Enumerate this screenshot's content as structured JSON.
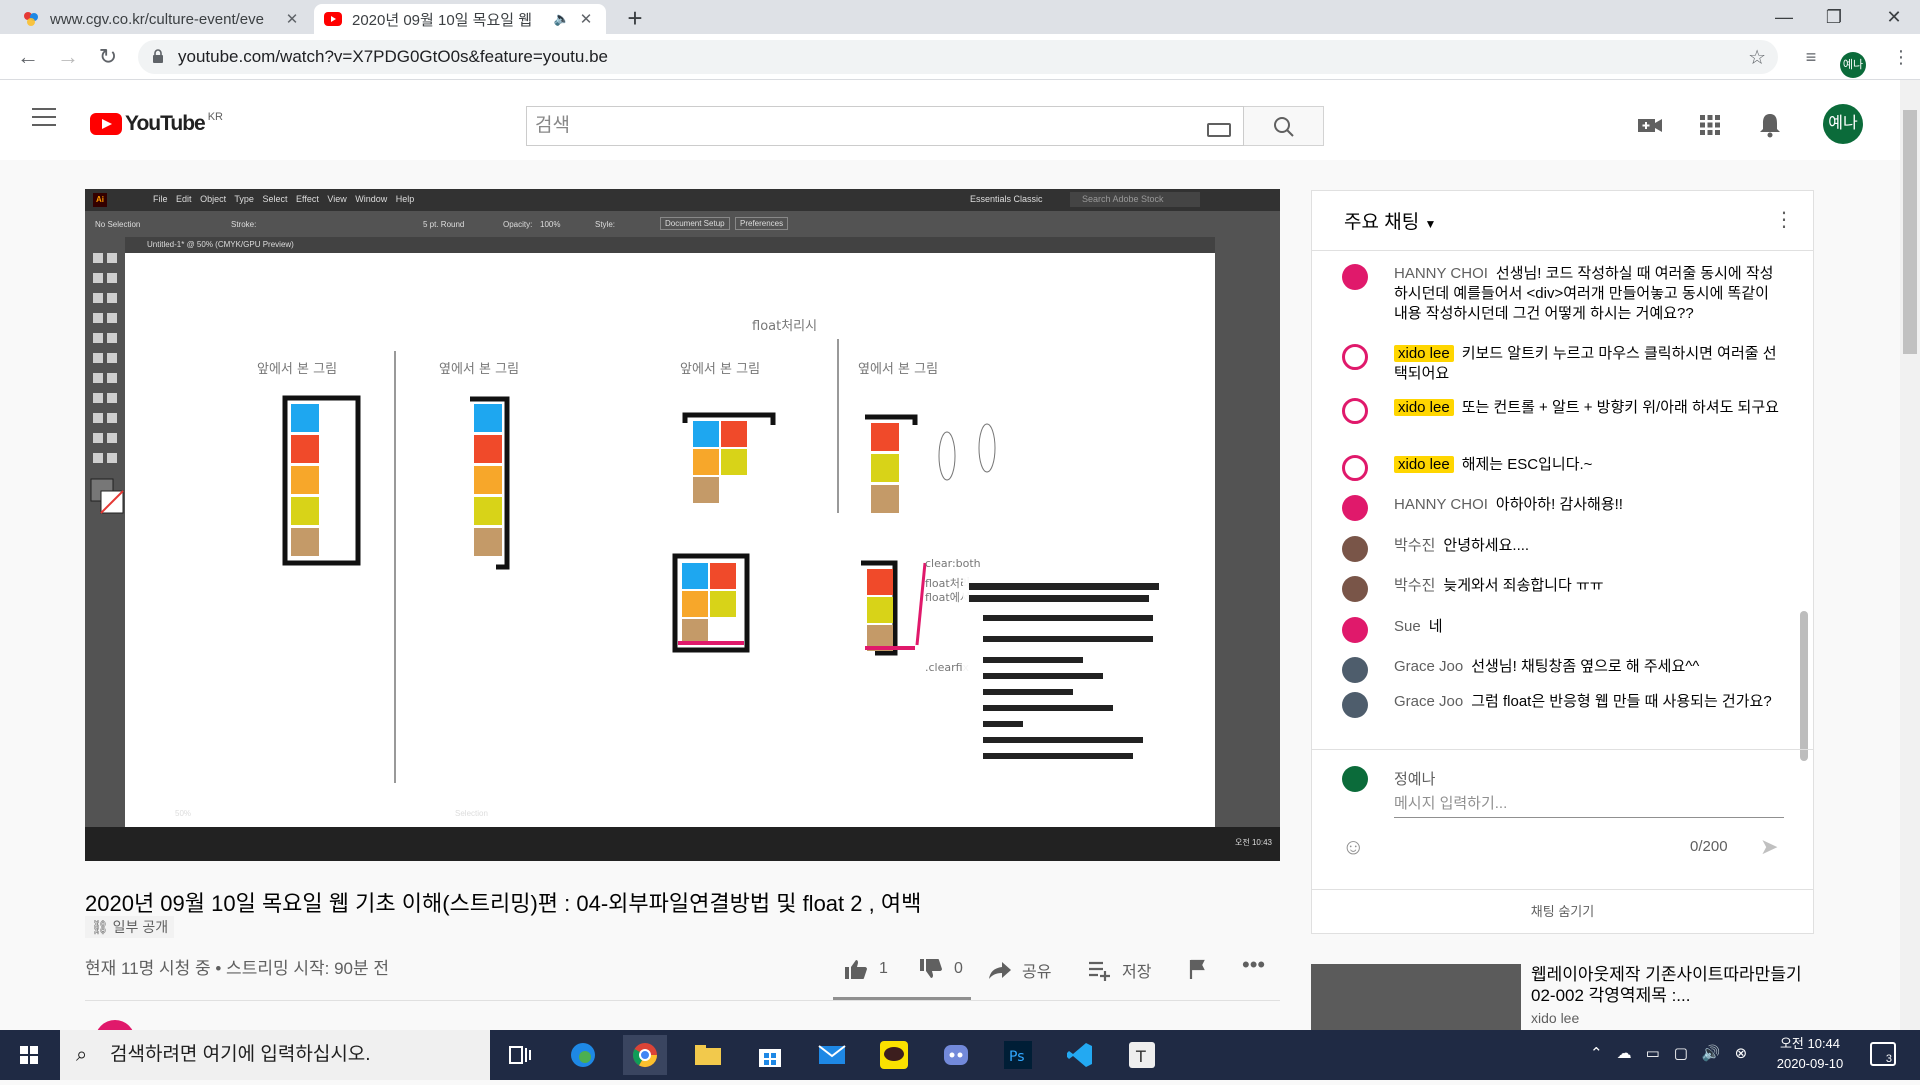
{
  "browser": {
    "tabs": [
      {
        "title": "www.cgv.co.kr/culture-event/eve",
        "icon": "cgv-favicon",
        "active": false
      },
      {
        "title": "2020년 09월 10일 목요일 웹",
        "icon": "youtube-favicon",
        "active": true
      }
    ],
    "url": "youtube.com/watch?v=X7PDG0GtO0s&feature=youtu.be",
    "profile_initials": "예나"
  },
  "youtube": {
    "logo_text": "YouTube",
    "region": "KR",
    "search_placeholder": "검색",
    "user_initials": "예나"
  },
  "video_content": {
    "menu": [
      "File",
      "Edit",
      "Object",
      "Type",
      "Select",
      "Effect",
      "View",
      "Window",
      "Help"
    ],
    "workspace": "Essentials Classic",
    "stock_search": "Search Adobe Stock",
    "selection_label": "No Selection",
    "stroke_label": "Stroke:",
    "brush": "5 pt. Round",
    "opacity_label": "Opacity:",
    "opacity": "100%",
    "style_label": "Style:",
    "doc_setup": "Document Setup",
    "preferences": "Preferences",
    "doc_tab": "Untitled-1* @ 50% (CMYK/GPU Preview)",
    "float_title": "float처리시",
    "label_front": "앞에서 본 그림",
    "label_side": "옆에서 본 그림",
    "clear_both": "clear:both",
    "float_note_1": "float처리",
    "float_note_2": "float에서",
    "clearfix": ".clearfix",
    "zoom": "50%",
    "status_tool": "Selection",
    "clock": "오전 10:43",
    "colors": {
      "blue": "#1ea7f0",
      "red": "#f04a2a",
      "orange": "#f7a72a",
      "yellow": "#d8d318",
      "tan": "#c49a68",
      "pink": "#e0196b"
    }
  },
  "video": {
    "title": "2020년 09월 10일 목요일 웹 기초 이해(스트리밍)편 : 04-외부파일연결방법 및 float 2 , 여백",
    "visibility": "일부 공개",
    "stats": "현재 11명 시청 중 • 스트리밍 시작: 90분 전",
    "likes": "1",
    "dislikes": "0",
    "share_label": "공유",
    "save_label": "저장"
  },
  "chat": {
    "header": "주요 채팅",
    "messages": [
      {
        "author": "HANNY CHOI",
        "text": "선생님! 코드 작성하실 때 여러줄 동시에 작성하시던데 예를들어서 <div>여러개 만들어놓고 동시에 똑같이 내용 작성하시던데 그건 어떻게 하시는 거예요??",
        "owner": false,
        "avatar_color": "#e0196b"
      },
      {
        "author": "xido lee",
        "text": "키보드 알트키 누르고 마우스 클릭하시면 여러줄 선택되어요",
        "owner": true,
        "avatar_color": "#e0196b"
      },
      {
        "author": "xido lee",
        "text": "또는 컨트롤 + 알트 + 방향키 위/아래 하셔도 되구요",
        "owner": true,
        "avatar_color": "#e0196b"
      },
      {
        "author": "xido lee",
        "text": "해제는 ESC입니다.~",
        "owner": true,
        "avatar_color": "#e0196b"
      },
      {
        "author": "HANNY CHOI",
        "text": "아하아하! 감사해용!!",
        "owner": false,
        "avatar_color": "#e0196b"
      },
      {
        "author": "박수진",
        "text": "안녕하세요....",
        "owner": false,
        "avatar_color": "#795548"
      },
      {
        "author": "박수진",
        "text": "늦게와서 죄송합니다 ㅠㅠ",
        "owner": false,
        "avatar_color": "#795548"
      },
      {
        "author": "Sue",
        "text": "네",
        "owner": false,
        "avatar_color": "#e0196b"
      },
      {
        "author": "Grace Joo",
        "text": "선생님! 채팅창좀 옆으로 해 주세요^^",
        "owner": false,
        "avatar_color": "#4e5d6c"
      },
      {
        "author": "Grace Joo",
        "text": "그럼 float은 반응형 웹 만들 때 사용되는 건가요?",
        "owner": false,
        "avatar_color": "#4e5d6c"
      }
    ],
    "input_user": "정예나",
    "input_placeholder": "메시지 입력하기...",
    "counter": "0/200",
    "hide_label": "채팅 숨기기"
  },
  "related": {
    "title": "웹레이아웃제작 기존사이트따라만들기 02-002 각영역제목 :...",
    "channel": "xido lee"
  },
  "taskbar": {
    "search_placeholder": "검색하려면 여기에 입력하십시오.",
    "time": "오전 10:44",
    "date": "2020-09-10",
    "notifications": "3"
  }
}
